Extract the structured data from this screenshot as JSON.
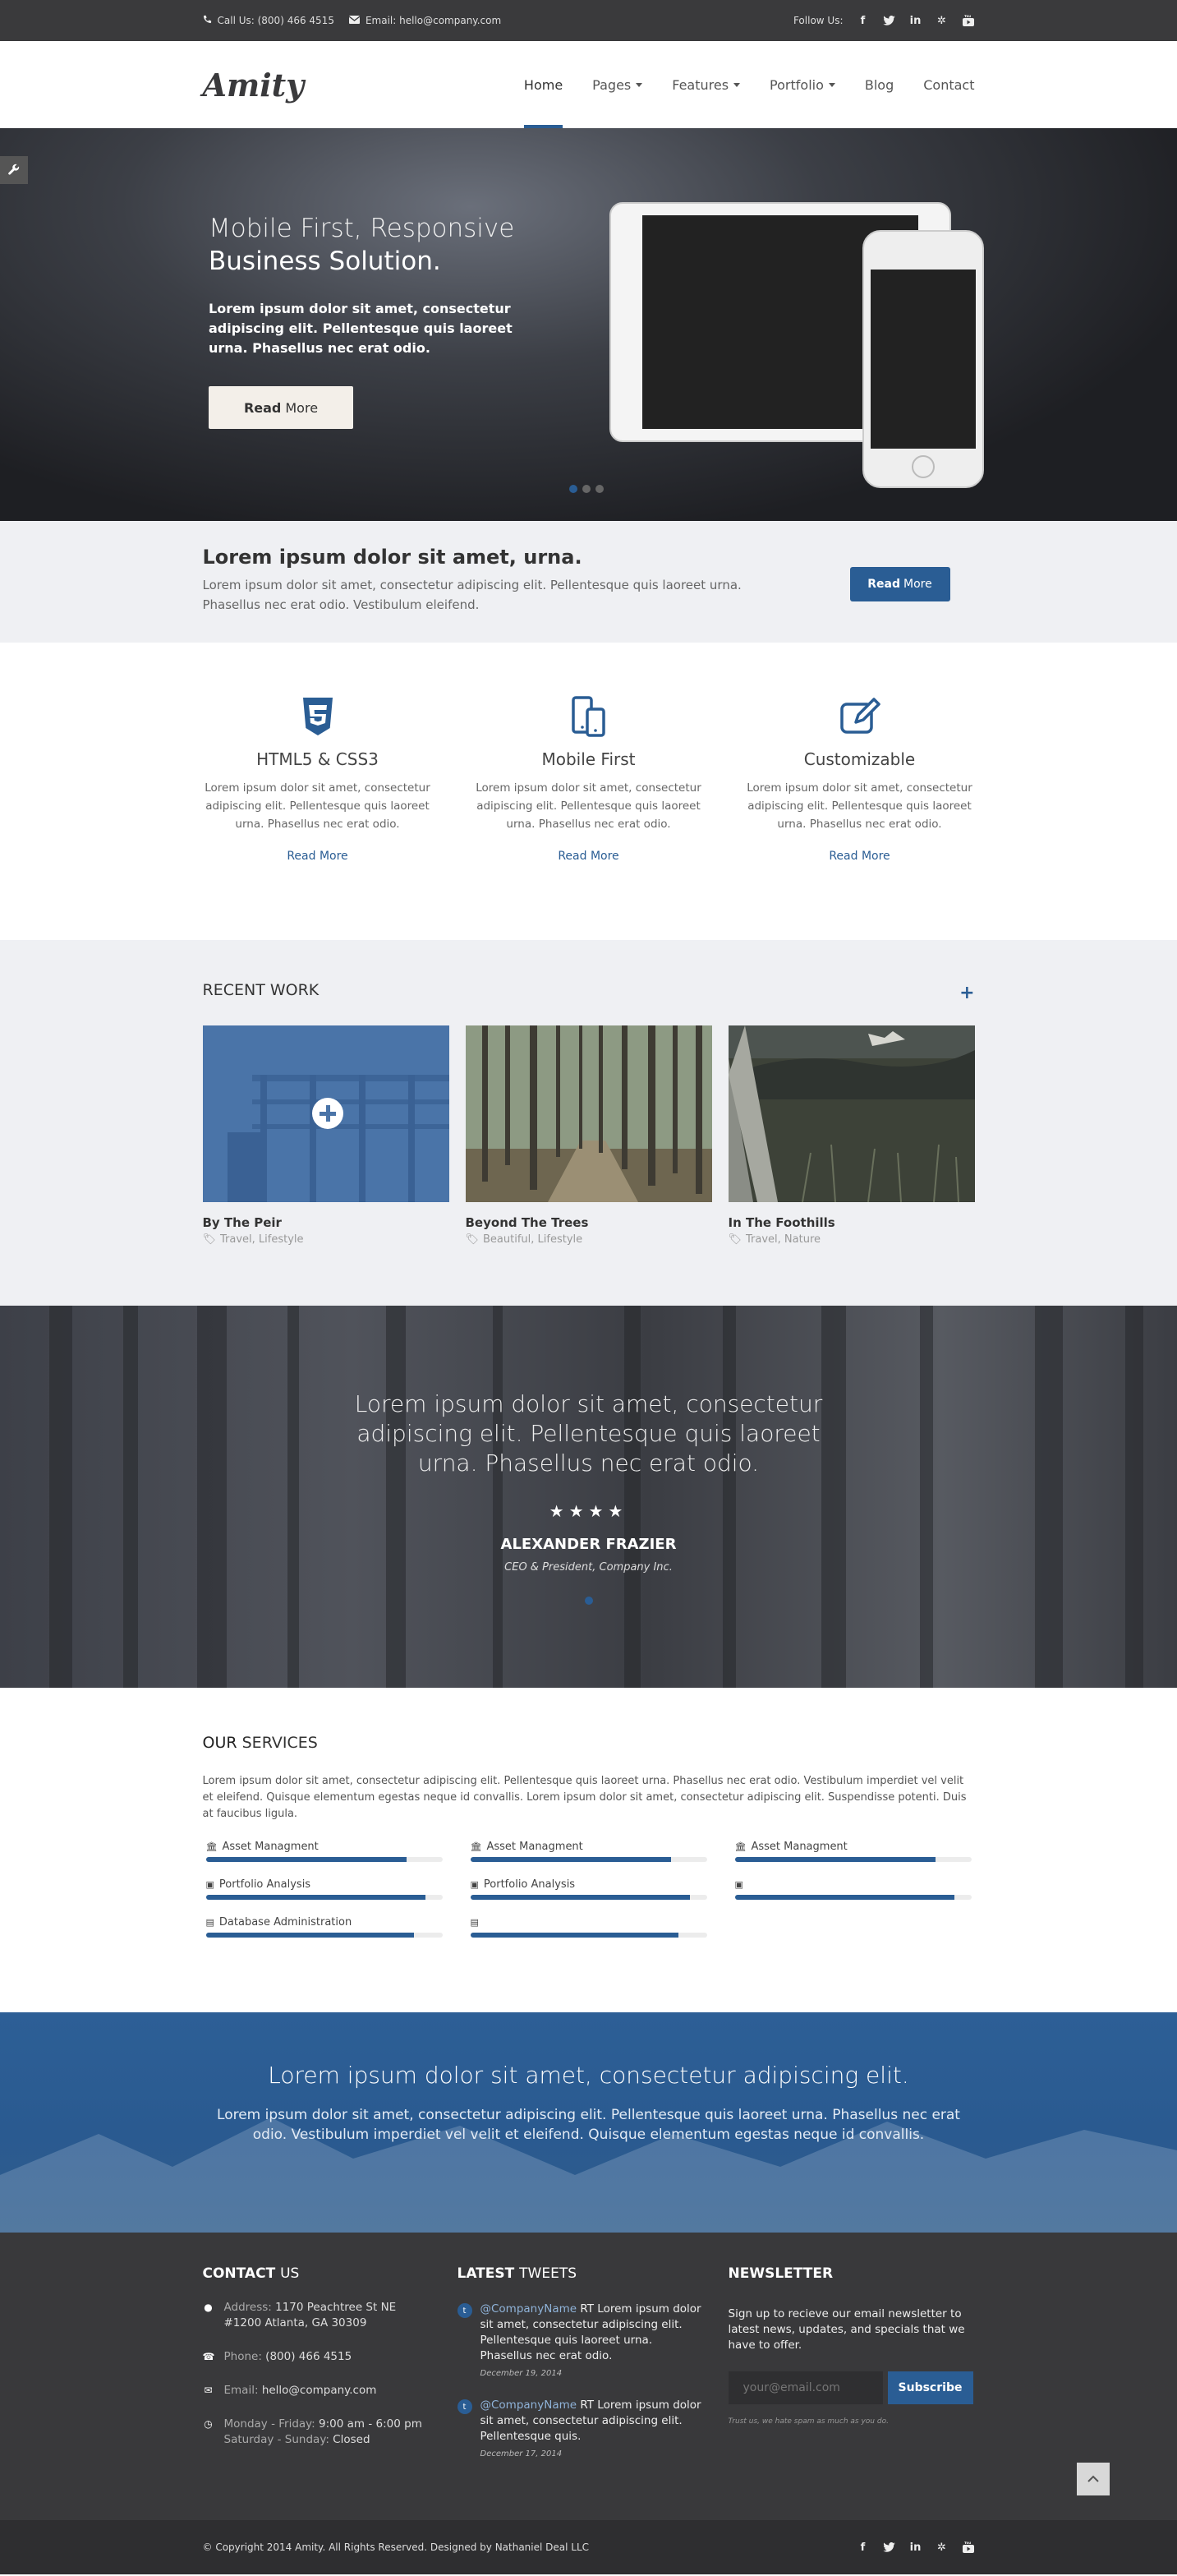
{
  "topbar": {
    "phone": "Call Us: (800) 466 4515",
    "email": "Email: hello@company.com",
    "follow": "Follow Us:"
  },
  "header": {
    "logo": "Amity",
    "nav": [
      "Home",
      "Pages",
      "Features",
      "Portfolio",
      "Blog",
      "Contact"
    ]
  },
  "hero": {
    "line1": "Mobile First, Responsive",
    "line2": "Business Solution.",
    "text": "Lorem ipsum dolor sit amet, consectetur adipiscing elit. Pellentesque quis laoreet urna. Phasellus nec erat odio.",
    "btn_bold": "Read",
    "btn_rest": "More"
  },
  "cta": {
    "title": "Lorem ipsum dolor sit amet, urna.",
    "text": "Lorem ipsum dolor sit amet, consectetur adipiscing elit. Pellentesque quis laoreet urna. Phasellus nec erat odio. Vestibulum eleifend.",
    "btn_bold": "Read",
    "btn_rest": "More"
  },
  "features": [
    {
      "title": "HTML5 & CSS3",
      "text": "Lorem ipsum dolor sit amet, consectetur adipiscing elit. Pellentesque quis laoreet urna. Phasellus nec erat odio.",
      "link": "Read More"
    },
    {
      "title": "Mobile First",
      "text": "Lorem ipsum dolor sit amet, consectetur adipiscing elit. Pellentesque quis laoreet urna. Phasellus nec erat odio.",
      "link": "Read More"
    },
    {
      "title": "Customizable",
      "text": "Lorem ipsum dolor sit amet, consectetur adipiscing elit. Pellentesque quis laoreet urna. Phasellus nec erat odio.",
      "link": "Read More"
    }
  ],
  "recent": {
    "title_a": "RECENT",
    "title_b": "WORK",
    "items": [
      {
        "title": "By The Peir",
        "tags": "Travel, Lifestyle"
      },
      {
        "title": "Beyond The Trees",
        "tags": "Beautiful, Lifestyle"
      },
      {
        "title": "In The Foothills",
        "tags": "Travel, Nature"
      }
    ]
  },
  "testimonial": {
    "quote": "Lorem ipsum dolor sit amet, consectetur adipiscing elit. Pellentesque quis laoreet urna. Phasellus nec erat odio.",
    "stars": "★★★★",
    "name": "ALEXANDER FRAZIER",
    "role": "CEO & President, Company Inc."
  },
  "services": {
    "title_a": "OUR",
    "title_b": "SERVICES",
    "text": "Lorem ipsum dolor sit amet, consectetur adipiscing elit. Pellentesque quis laoreet urna. Phasellus nec erat odio. Vestibulum imperdiet vel velit et eleifend. Quisque elementum egestas neque id convallis. Lorem ipsum dolor sit amet, consectetur adipiscing elit. Suspendisse potenti. Duis at faucibus ligula.",
    "columns": [
      [
        {
          "label": "Asset Managment",
          "pct": 85,
          "icon": "bank-icon"
        },
        {
          "label": "Portfolio Analysis",
          "pct": 93,
          "icon": "money-icon"
        },
        {
          "label": "Database Administration",
          "pct": 88,
          "icon": "database-icon"
        }
      ],
      [
        {
          "label": "Asset Managment",
          "pct": 85,
          "icon": "bank-icon"
        },
        {
          "label": "Portfolio Analysis",
          "pct": 93,
          "icon": "money-icon"
        },
        {
          "label": "",
          "pct": 88,
          "icon": "database-icon"
        }
      ],
      [
        {
          "label": "Asset Managment",
          "pct": 85,
          "icon": "bank-icon"
        },
        {
          "label": "",
          "pct": 93,
          "icon": "money-icon"
        }
      ]
    ]
  },
  "banner": {
    "title": "Lorem ipsum dolor sit amet, consectetur adipiscing elit.",
    "text": "Lorem ipsum dolor sit amet, consectetur adipiscing elit. Pellentesque quis laoreet urna. Phasellus nec erat odio. Vestibulum imperdiet vel velit et eleifend. Quisque elementum egestas neque id convallis."
  },
  "footer": {
    "contact": {
      "title_a": "CONTACT",
      "title_b": "US",
      "address_label": "Address:",
      "address_value": "1170 Peachtree St NE #1200 Atlanta, GA 30309",
      "phone_label": "Phone:",
      "phone_value": "(800) 466 4515",
      "email_label": "Email:",
      "email_value": "hello@company.com",
      "hours_label": "Monday - Friday:",
      "hours_value": "9:00 am - 6:00 pm",
      "weekend_label": "Saturday - Sunday:",
      "weekend_value": "Closed"
    },
    "tweets": {
      "title_a": "LATEST",
      "title_b": "TWEETS",
      "items": [
        {
          "handle": "@CompanyName",
          "text": "RT Lorem ipsum dolor sit amet, consectetur adipiscing elit. Pellentesque quis laoreet urna. Phasellus nec erat odio.",
          "date": "December 19, 2014"
        },
        {
          "handle": "@CompanyName",
          "text": "RT Lorem ipsum dolor sit amet, consectetur adipiscing elit. Pellentesque quis.",
          "date": "December 17, 2014"
        }
      ]
    },
    "newsletter": {
      "title": "NEWSLETTER",
      "text": "Sign up to recieve our email newsletter to latest news, updates, and specials that we have to offer.",
      "placeholder": "your@email.com",
      "button": "Subscribe",
      "small": "Trust us, we hate spam as much as you do."
    }
  },
  "bottom": {
    "copyright": "© Copyright 2014 Amity. All Rights Reserved. Designed by Nathaniel Deal LLC"
  },
  "colors": {
    "accent": "#2a5d94",
    "dark": "#39393b",
    "light_band": "#eff0f3"
  }
}
